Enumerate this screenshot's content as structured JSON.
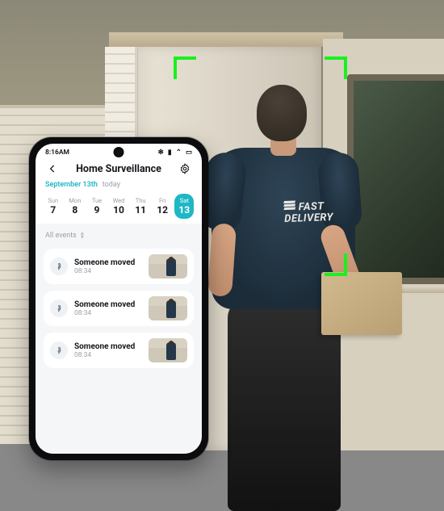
{
  "scene": {
    "shirt_brand_line1": "FAST",
    "shirt_brand_line2": "DELIVERY",
    "tracker_color": "#19f01e"
  },
  "statusbar": {
    "time": "8:16AM",
    "icons": {
      "bt": "✻",
      "wifi": "⌃",
      "signal": "▮",
      "batt": "▭"
    }
  },
  "header": {
    "title": "Home Surveillance"
  },
  "subhead": {
    "date": "September 13th",
    "today": "today"
  },
  "calendar": {
    "days": [
      {
        "dow": "Sun",
        "num": "7"
      },
      {
        "dow": "Mon",
        "num": "8"
      },
      {
        "dow": "Tue",
        "num": "9"
      },
      {
        "dow": "Wed",
        "num": "10"
      },
      {
        "dow": "Thu",
        "num": "11"
      },
      {
        "dow": "Fri",
        "num": "12"
      },
      {
        "dow": "Sat",
        "num": "13"
      }
    ],
    "active_index": 6
  },
  "filter": {
    "label": "All events"
  },
  "events": [
    {
      "title": "Someone moved",
      "time": "08:34"
    },
    {
      "title": "Someone moved",
      "time": "08:34"
    },
    {
      "title": "Someone moved",
      "time": "08:34"
    }
  ]
}
